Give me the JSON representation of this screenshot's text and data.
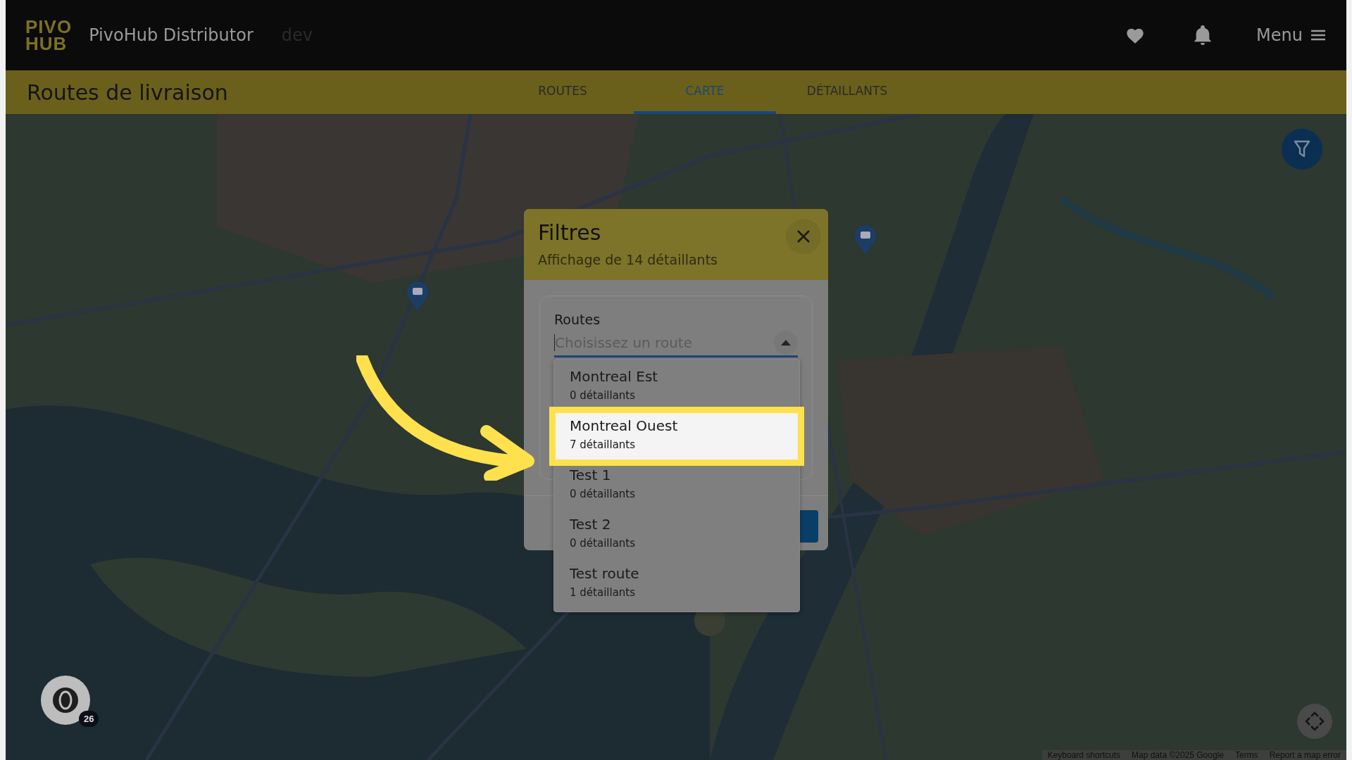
{
  "header": {
    "logo": [
      "PIVO",
      "HUB"
    ],
    "app_name": "PivoHub Distributor",
    "environment": "dev",
    "menu_label": "Menu"
  },
  "subheader": {
    "title": "Routes de livraison",
    "tabs": [
      {
        "label": "ROUTES",
        "selected": false
      },
      {
        "label": "CARTE",
        "selected": true
      },
      {
        "label": "DÉTAILLANTS",
        "selected": false
      }
    ]
  },
  "map": {
    "cluster_count": "26",
    "attribution": [
      "Keyboard shortcuts",
      "Map data ©2025 Google",
      "Terms",
      "Report a map error"
    ]
  },
  "dialog": {
    "title": "Filtres",
    "subtitle": "Affichage de 14 détaillants",
    "field": {
      "label": "Routes",
      "placeholder": "Choisissez un route",
      "expanded": true
    },
    "options": [
      {
        "name": "Montreal Est",
        "count": "0 détaillants",
        "selected": false
      },
      {
        "name": "Montreal Ouest",
        "count": "7 détaillants",
        "selected": true
      },
      {
        "name": "Test 1",
        "count": "0 détaillants",
        "selected": false
      },
      {
        "name": "Test 2",
        "count": "0 détaillants",
        "selected": false
      },
      {
        "name": "Test route",
        "count": "1 détaillants",
        "selected": false
      }
    ]
  }
}
